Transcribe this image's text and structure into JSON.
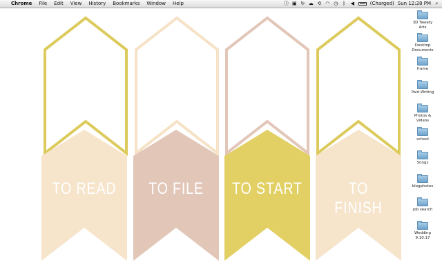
{
  "menubar": {
    "app": "Chrome",
    "menus": [
      "File",
      "Edit",
      "View",
      "History",
      "Bookmarks",
      "Window",
      "Help"
    ],
    "battery_status": "(Charged)",
    "clock": "Sun 12:28 PM"
  },
  "tags": [
    {
      "label": "TO READ",
      "color": "#f6e4cb"
    },
    {
      "label": "TO FILE",
      "color": "#e2c6b8"
    },
    {
      "label": "TO START",
      "color": "#e2d064"
    },
    {
      "label": "TO FINISH",
      "color": "#f6e4cb"
    }
  ],
  "outline_colors": [
    "#dccb5c",
    "#f6e2c6",
    "#e2c6b8",
    "#dccb5c"
  ],
  "desktop": [
    {
      "label": "3D Tweety\nArts"
    },
    {
      "label": "Desktop\nDocuments"
    },
    {
      "label": "frame"
    },
    {
      "label": "Paid Writing"
    },
    {
      "label": "Photos &\nVideos"
    },
    {
      "label": "school"
    },
    {
      "label": "Songs"
    },
    {
      "label": "blogphotos"
    },
    {
      "label": "job search"
    },
    {
      "label": "Wedding\n9.10.17"
    }
  ]
}
